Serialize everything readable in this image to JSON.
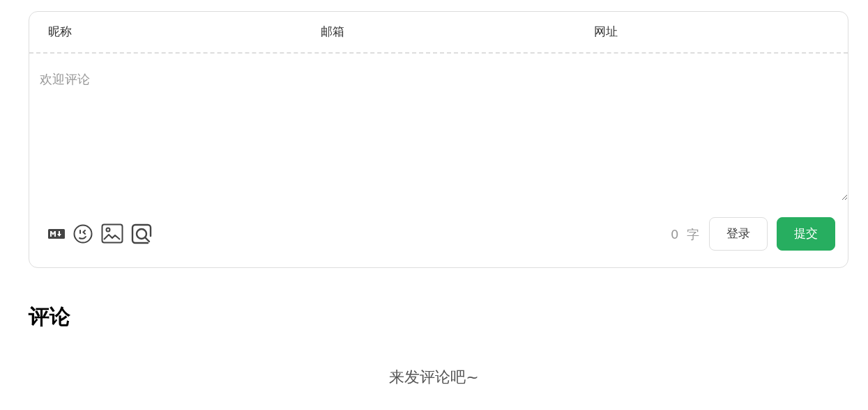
{
  "fields": [
    {
      "label": "昵称"
    },
    {
      "label": "邮箱"
    },
    {
      "label": "网址"
    }
  ],
  "editor": {
    "placeholder": "欢迎评论"
  },
  "word_count": {
    "count": "0",
    "unit": "字"
  },
  "buttons": [
    {
      "label": "登录",
      "kind": "secondary"
    },
    {
      "label": "提交",
      "kind": "primary"
    }
  ],
  "comments": {
    "title": "评论",
    "empty_text": "来发评论吧~"
  }
}
